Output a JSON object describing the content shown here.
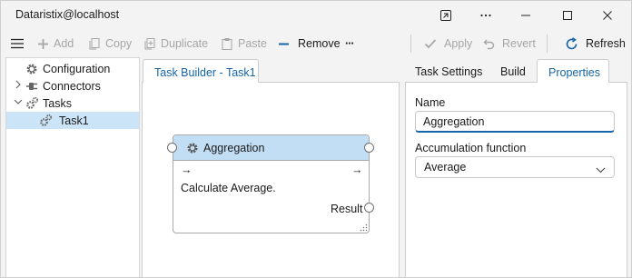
{
  "window": {
    "title": "Dataristix@localhost"
  },
  "toolbar": {
    "add": "Add",
    "copy": "Copy",
    "duplicate": "Duplicate",
    "paste": "Paste",
    "remove": "Remove",
    "more": "···",
    "apply": "Apply",
    "revert": "Revert",
    "refresh": "Refresh"
  },
  "tree": {
    "items": [
      {
        "label": "Configuration"
      },
      {
        "label": "Connectors"
      },
      {
        "label": "Tasks"
      },
      {
        "label": "Task1"
      }
    ]
  },
  "builder": {
    "tab_label": "Task Builder - Task1",
    "node": {
      "title": "Aggregation",
      "in_arrow": "→",
      "out_arrow": "→",
      "description": "Calculate Average.",
      "output_label": "Result"
    }
  },
  "properties": {
    "tabs": [
      "Task Settings",
      "Build",
      "Properties"
    ],
    "name_label": "Name",
    "name_value": "Aggregation",
    "function_label": "Accumulation function",
    "function_value": "Average"
  },
  "colors": {
    "accent": "#1565a8",
    "selection": "#cce4f7",
    "node_header": "#c2def5"
  }
}
